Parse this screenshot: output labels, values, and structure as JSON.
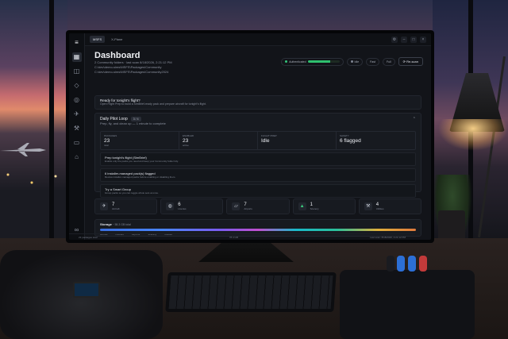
{
  "app": {
    "tabs": [
      "MSFS",
      "X-Plane"
    ],
    "active_tab": "MSFS",
    "sidebar_icons": [
      "grid-icon",
      "layers-icon",
      "package-icon",
      "compass-icon",
      "plane-icon",
      "wrench-icon",
      "folder-icon",
      "tag-icon",
      "link-icon",
      "settings-icon",
      "user-icon"
    ]
  },
  "header": {
    "title": "Dashboard",
    "subtitle_line1": "2 Community folders · last scan 8/18/2026, 2:21:12 PM",
    "subtitle_line2": "C:\\dev\\demo-sims\\MSFS\\Packages\\Community",
    "subtitle_line3": "C:\\dev\\demo-sims\\MSFS\\Packages\\Community2024"
  },
  "status": {
    "auth_label": "Authenticated",
    "progress": 0.72,
    "sim_label": "Idle",
    "mode_labels": [
      "Fast",
      "Full"
    ],
    "rescan_label": "Re-scan"
  },
  "ready": {
    "title": "Ready for tonight's flight?",
    "desc": "Open Flight Prep to build a SimBrief-ready pack and prepare aircraft for tonight's flight."
  },
  "loop": {
    "title": "Daily Pilot Loop",
    "sub": "Prep, fly, and clean up — 1 minute to complete",
    "badge": "3 / 4",
    "stats": [
      {
        "label": "Packages",
        "value": "23",
        "sub": "total"
      },
      {
        "label": "Enabled",
        "value": "23",
        "sub": "active"
      },
      {
        "label": "Flight Prep",
        "value": "Idle",
        "sub": ""
      },
      {
        "label": "Safety",
        "value": "6 flagged",
        "sub": ""
      }
    ],
    "steps": [
      {
        "title": "Prep tonight's flight (SimBrief)",
        "desc": "Enable only the packs you need and keep your Community folder tidy."
      },
      {
        "title": "6 installer-managed pack(s) flagged",
        "desc": "Review installer-managed packs before enabling or disabling them."
      },
      {
        "title": "Try a Smart Group",
        "desc": "Group packs so you can toggle whole sets at once."
      }
    ]
  },
  "tiles": [
    {
      "icon": "plane-icon",
      "value": "7",
      "label": "Aircraft"
    },
    {
      "icon": "globe-icon",
      "value": "6",
      "label": "Liveries"
    },
    {
      "icon": "map-icon",
      "value": "7",
      "label": "Airports"
    },
    {
      "icon": "mountain-icon",
      "value": "1",
      "label": "Scenery"
    },
    {
      "icon": "wrench-icon",
      "value": "4",
      "label": "Utilities"
    }
  ],
  "storage": {
    "title": "Storage",
    "size": "58.3 GB total",
    "legend": [
      "Aircraft",
      "Liveries",
      "Airports",
      "Scenery",
      "Utilities"
    ]
  },
  "footer": {
    "left": "23 packages total",
    "center": "78.4 GB",
    "right": "Last scan: 8/18/2026, 2:21:12 PM"
  }
}
